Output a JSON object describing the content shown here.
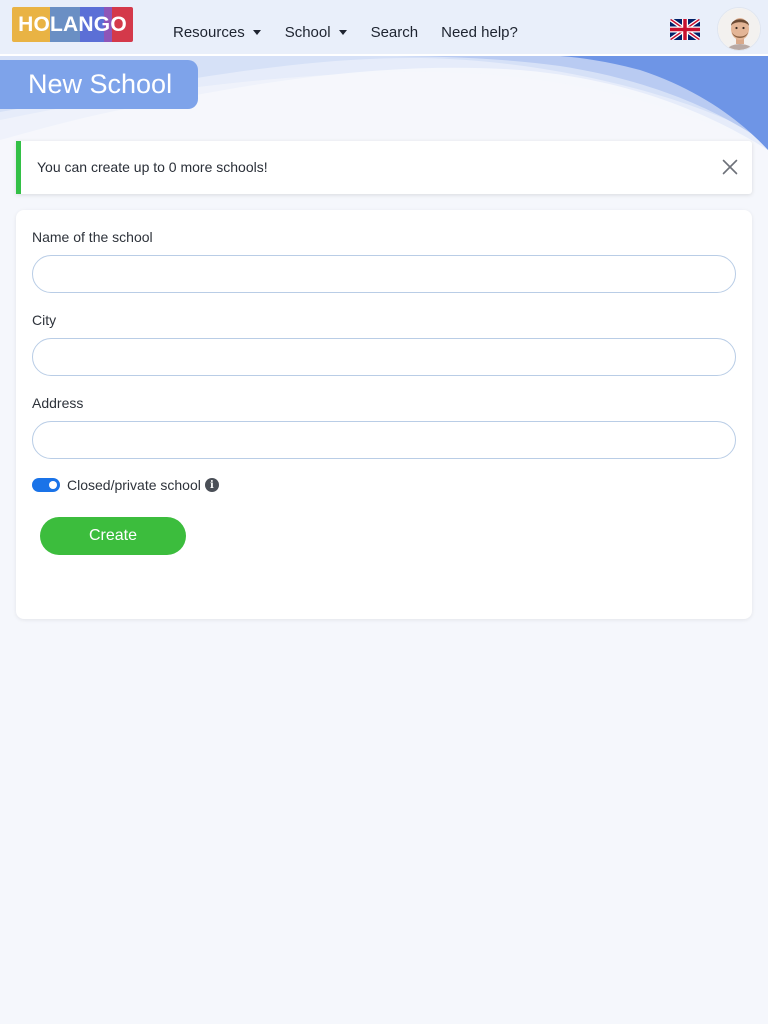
{
  "brand": {
    "logo_text": "HOLANGO",
    "logo_colors": [
      "#e9b344",
      "#6a8fc4",
      "#5b6fd6",
      "#8e55b8",
      "#d4394a"
    ]
  },
  "nav": {
    "items": [
      {
        "label": "Resources",
        "has_dropdown": true
      },
      {
        "label": "School",
        "has_dropdown": true
      },
      {
        "label": "Search",
        "has_dropdown": false
      },
      {
        "label": "Need help?",
        "has_dropdown": false
      }
    ],
    "language_icon": "uk-flag-icon",
    "avatar_icon": "user-avatar"
  },
  "page": {
    "title": "New School"
  },
  "alert": {
    "message": "You can create up to 0 more schools!",
    "accent_color": "#33c046",
    "close_icon": "close-icon"
  },
  "form": {
    "fields": [
      {
        "label": "Name of the school",
        "value": "",
        "placeholder": ""
      },
      {
        "label": "City",
        "value": "",
        "placeholder": ""
      },
      {
        "label": "Address",
        "value": "",
        "placeholder": ""
      }
    ],
    "private_toggle": {
      "label": "Closed/private school",
      "checked": true,
      "info_icon": "info-icon"
    },
    "submit_label": "Create",
    "submit_color": "#3cbd3d"
  },
  "colors": {
    "accent": "#7ea3ea",
    "background": "#f5f7fc",
    "toggle_on": "#1a73e8"
  }
}
